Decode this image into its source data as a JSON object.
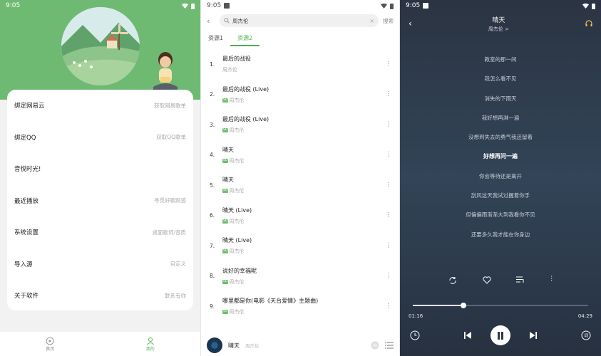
{
  "status": {
    "time1": "9:05",
    "time2": "9:05",
    "time3": "9:05"
  },
  "settings": {
    "rows": [
      {
        "label": "绑定网易云",
        "hint": "获取网易歌单"
      },
      {
        "label": "绑定QQ",
        "hint": "获取QQ歌单"
      },
      {
        "label": "音悦时光!",
        "hint": ""
      },
      {
        "label": "最近播放",
        "hint": "寻觅好歌踪迹"
      },
      {
        "label": "系统设置",
        "hint": "桌面歌词/音质"
      },
      {
        "label": "导入源",
        "hint": "自定义"
      },
      {
        "label": "关于软件",
        "hint": "联系有你"
      }
    ],
    "nav": [
      {
        "label": "首页"
      },
      {
        "label": "我的"
      }
    ]
  },
  "search": {
    "query": "周杰伦",
    "action": "搜索",
    "tabs": [
      "资源1",
      "资源2"
    ],
    "results": [
      {
        "idx": "1.",
        "title": "最后的战役",
        "artist": "周杰伦",
        "sq": false
      },
      {
        "idx": "2.",
        "title": "最后的战役 (Live)",
        "artist": "周杰伦",
        "sq": true
      },
      {
        "idx": "3.",
        "title": "最后的战役 (Live)",
        "artist": "周杰伦",
        "sq": true
      },
      {
        "idx": "4.",
        "title": "晴天",
        "artist": "周杰伦",
        "sq": true
      },
      {
        "idx": "5.",
        "title": "晴天",
        "artist": "周杰伦",
        "sq": true
      },
      {
        "idx": "6.",
        "title": "晴天 (Live)",
        "artist": "周杰伦",
        "sq": true
      },
      {
        "idx": "7.",
        "title": "晴天 (Live)",
        "artist": "周杰伦",
        "sq": true
      },
      {
        "idx": "8.",
        "title": "说好的幸福呢",
        "artist": "周杰伦",
        "sq": true
      },
      {
        "idx": "9.",
        "title": "哪里都是你(电影《天台爱情》主题曲)",
        "artist": "周杰伦",
        "sq": true
      }
    ],
    "sq_label": "SQ",
    "mini_player": {
      "title": "晴天",
      "artist": "周杰伦"
    }
  },
  "player": {
    "title": "晴天",
    "artist": "周杰伦 >",
    "lyrics": [
      "教室的那一间",
      "我怎么看不见",
      "消失的下雨天",
      "我好想再淋一遍",
      "没想到失去的勇气我还留着",
      "好想再问一遍",
      "你会等待还是离开",
      "刮风这天我试过握着你手",
      "但偏偏雨渐渐大到我看你不见",
      "还要多久我才能在你身边"
    ],
    "current_line": 5,
    "elapsed": "01:16",
    "duration": "04:29",
    "progress": 0.29
  },
  "colors": {
    "accent": "#4caf50",
    "hero": "#6fba73"
  }
}
